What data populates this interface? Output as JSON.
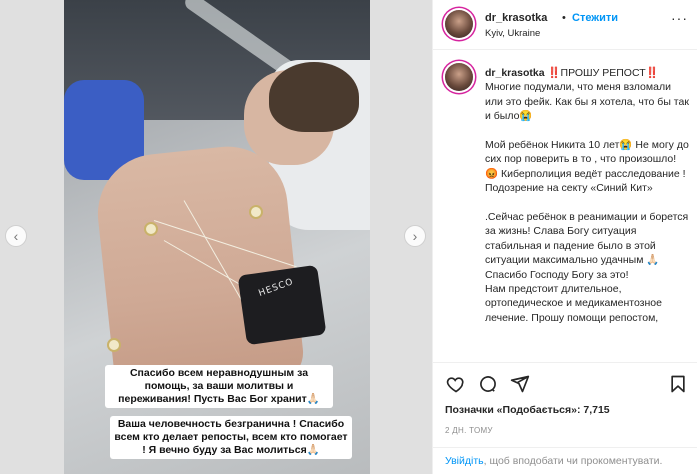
{
  "post": {
    "photo_captions": [
      "Спасибо всем неравнодушным за помощь, за ваши молитвы и переживания! Пусть Вас Бог хранит🙏🏻",
      "Ваша человечность безгранична ! Спасибо всем кто делает репосты, всем кто помогает ! Я вечно буду за Вас молиться🙏🏻"
    ],
    "cuff_label": "HESCO",
    "nav": {
      "prev_icon": "chevron-left-icon",
      "next_icon": "chevron-right-icon",
      "prev": "‹",
      "next": "›"
    }
  },
  "header": {
    "username": "dr_krasotka",
    "separator": "•",
    "follow_label": "Стежити",
    "location": "Kyiv, Ukraine",
    "more": "···"
  },
  "comment": {
    "author": "dr_krasotka",
    "paragraphs": [
      "‼️ПРОШУ РЕПОСТ‼️ Многие подумали, что меня взломали или это фейк. Как бы я хотела, что бы так и было😭",
      "Мой ребёнок Никита 10 лет😭 Не могу до сих пор поверить в то , что произошло! 😡 Киберполиция ведёт расследование ! Подозрение на секту «Синий Кит»",
      ".Сейчас ребёнок в реанимации и борется за жизнь! Слава Богу ситуация стабильная и падение было в этой ситуации максимально удачным 🙏🏻Спасибо Господу Богу за это!\nНам предстоит длительное, ортопедическое и медикаментозное лечение. Прошу помощи репостом,"
    ]
  },
  "actions": {
    "like_icon": "heart-icon",
    "comment_icon": "comment-icon",
    "share_icon": "share-icon",
    "save_icon": "bookmark-icon"
  },
  "likes_text": "Позначки «Подобається»: 7,715",
  "time_text": "2 ДН. ТОМУ",
  "login": {
    "link": "Увійдіть",
    "rest": ", щоб вподобати чи прокоментувати."
  }
}
